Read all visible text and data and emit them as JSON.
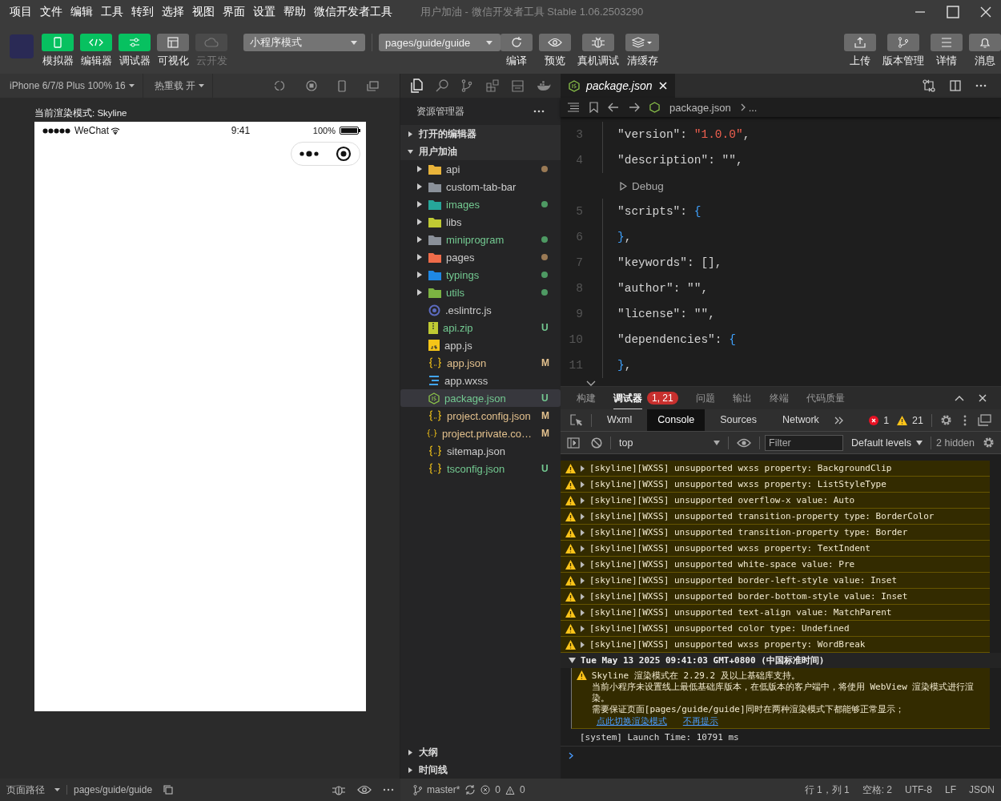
{
  "menu": [
    "项目",
    "文件",
    "编辑",
    "工具",
    "转到",
    "选择",
    "视图",
    "界面",
    "设置",
    "帮助",
    "微信开发者工具"
  ],
  "window": {
    "title": "用户加油 - 微信开发者工具 Stable 1.06.2503290"
  },
  "toolbar": {
    "modes": [
      {
        "label": "模拟器",
        "on": true,
        "disabled": false
      },
      {
        "label": "编辑器",
        "on": true,
        "disabled": false
      },
      {
        "label": "调试器",
        "on": true,
        "disabled": false
      },
      {
        "label": "可视化",
        "on": false,
        "disabled": false
      },
      {
        "label": "云开发",
        "on": false,
        "disabled": true
      }
    ],
    "mode_select": "小程序模式",
    "page_select": "pages/guide/guide",
    "actions": [
      "编译",
      "预览",
      "真机调试",
      "清缓存"
    ],
    "right_actions": [
      "上传",
      "版本管理",
      "详情",
      "消息"
    ]
  },
  "simulator": {
    "device": "iPhone 6/7/8 Plus 100% 16",
    "hot_reload": "热重载 开",
    "render_mode": "当前渲染模式: Skyline",
    "carrier": "WeChat",
    "time": "9:41",
    "battery": "100%"
  },
  "explorer": {
    "title": "资源管理器",
    "sections": [
      {
        "label": "打开的编辑器",
        "expanded": false
      },
      {
        "label": "用户加油",
        "expanded": true
      }
    ],
    "files": [
      {
        "name": "api",
        "kind": "folder",
        "color": "#e8b33a",
        "untracked": false,
        "modified": true,
        "selected": false
      },
      {
        "name": "custom-tab-bar",
        "kind": "folder",
        "color": "#8a9099",
        "untracked": false,
        "modified": false,
        "selected": false
      },
      {
        "name": "images",
        "kind": "folder",
        "color": "#26a69a",
        "untracked": true,
        "modified": false,
        "selected": false
      },
      {
        "name": "libs",
        "kind": "folder",
        "color": "#c0ca33",
        "untracked": false,
        "modified": false,
        "selected": false
      },
      {
        "name": "miniprogram",
        "kind": "folder",
        "color": "#8a9099",
        "untracked": true,
        "modified": false,
        "selected": false
      },
      {
        "name": "pages",
        "kind": "folder",
        "color": "#ef6c4a",
        "untracked": false,
        "modified": true,
        "selected": false
      },
      {
        "name": "typings",
        "kind": "folder",
        "color": "#1e88e5",
        "untracked": true,
        "modified": false,
        "selected": false
      },
      {
        "name": "utils",
        "kind": "folder",
        "color": "#7cb342",
        "untracked": true,
        "modified": false,
        "selected": false
      },
      {
        "name": ".eslintrc.js",
        "kind": "eslint",
        "untracked": false,
        "modified": false,
        "selected": false
      },
      {
        "name": "api.zip",
        "kind": "zip",
        "untracked": true,
        "modified": false,
        "badge": "U",
        "selected": false
      },
      {
        "name": "app.js",
        "kind": "js",
        "untracked": false,
        "modified": false,
        "selected": false
      },
      {
        "name": "app.json",
        "kind": "json",
        "untracked": false,
        "modified": true,
        "badge": "M",
        "selected": false
      },
      {
        "name": "app.wxss",
        "kind": "wxss",
        "untracked": false,
        "modified": false,
        "selected": false
      },
      {
        "name": "package.json",
        "kind": "node",
        "untracked": true,
        "modified": false,
        "badge": "U",
        "selected": true
      },
      {
        "name": "project.config.json",
        "kind": "json",
        "untracked": false,
        "modified": true,
        "badge": "M",
        "selected": false
      },
      {
        "name": "project.private.co…",
        "kind": "json",
        "untracked": false,
        "modified": true,
        "badge": "M",
        "selected": false
      },
      {
        "name": "sitemap.json",
        "kind": "json",
        "untracked": false,
        "modified": false,
        "selected": false
      },
      {
        "name": "tsconfig.json",
        "kind": "json",
        "untracked": true,
        "modified": false,
        "badge": "U",
        "selected": false
      }
    ],
    "bottom_sections": [
      {
        "label": "大纲",
        "expanded": false
      },
      {
        "label": "时间线",
        "expanded": false
      }
    ]
  },
  "editor": {
    "tab": "package.json",
    "breadcrumb": [
      "package.json",
      "..."
    ],
    "lines": [
      {
        "kind": "code",
        "num": "3",
        "tokens": [
          {
            "kind": "key",
            "text": "\"version\""
          },
          {
            "kind": "punct",
            "text": ": "
          },
          {
            "kind": "str",
            "text": "\"1.0.0\""
          },
          {
            "kind": "punct",
            "text": ","
          }
        ]
      },
      {
        "kind": "code",
        "num": "4",
        "tokens": [
          {
            "kind": "key",
            "text": "\"description\""
          },
          {
            "kind": "punct",
            "text": ": \"\","
          }
        ]
      },
      {
        "kind": "lens",
        "text": "Debug"
      },
      {
        "kind": "code",
        "num": "5",
        "tokens": [
          {
            "kind": "key",
            "text": "\"scripts\""
          },
          {
            "kind": "punct",
            "text": ": "
          },
          {
            "kind": "brace",
            "text": "{"
          }
        ]
      },
      {
        "kind": "code",
        "num": "6",
        "tokens": [
          {
            "kind": "brace",
            "text": "}"
          },
          {
            "kind": "punct",
            "text": ","
          }
        ]
      },
      {
        "kind": "code",
        "num": "7",
        "tokens": [
          {
            "kind": "key",
            "text": "\"keywords\""
          },
          {
            "kind": "punct",
            "text": ": [],"
          }
        ]
      },
      {
        "kind": "code",
        "num": "8",
        "tokens": [
          {
            "kind": "key",
            "text": "\"author\""
          },
          {
            "kind": "punct",
            "text": ": \"\","
          }
        ]
      },
      {
        "kind": "code",
        "num": "9",
        "tokens": [
          {
            "kind": "key",
            "text": "\"license\""
          },
          {
            "kind": "punct",
            "text": ": \"\","
          }
        ]
      },
      {
        "kind": "code",
        "num": "10",
        "tokens": [
          {
            "kind": "key",
            "text": "\"dependencies\""
          },
          {
            "kind": "punct",
            "text": ": "
          },
          {
            "kind": "brace",
            "text": "{"
          }
        ]
      },
      {
        "kind": "code",
        "num": "11",
        "tokens": [
          {
            "kind": "brace",
            "text": "}"
          },
          {
            "kind": "punct",
            "text": ","
          }
        ]
      }
    ]
  },
  "panel": {
    "tabs": [
      {
        "label": "构建",
        "selected": false
      },
      {
        "label": "调试器",
        "selected": true,
        "badge": "1, 21"
      },
      {
        "label": "问题",
        "selected": false
      },
      {
        "label": "输出",
        "selected": false
      },
      {
        "label": "终端",
        "selected": false
      },
      {
        "label": "代码质量",
        "selected": false
      }
    ],
    "devtools_tabs": [
      {
        "label": "Wxml",
        "selected": false
      },
      {
        "label": "Console",
        "selected": true
      },
      {
        "label": "Sources",
        "selected": false
      },
      {
        "label": "Network",
        "selected": false
      }
    ],
    "errors": "1",
    "warnings": "21",
    "console": {
      "context": "top",
      "filter_placeholder": "Filter",
      "levels": "Default levels",
      "hidden": "2 hidden",
      "warnings": [
        "[skyline][WXSS] unsupported wxss property: BackgroundClip",
        "[skyline][WXSS] unsupported wxss property: ListStyleType",
        "[skyline][WXSS] unsupported overflow-x value: Auto",
        "[skyline][WXSS] unsupported transition-property type: BorderColor",
        "[skyline][WXSS] unsupported transition-property type: Border",
        "[skyline][WXSS] unsupported wxss property: TextIndent",
        "[skyline][WXSS] unsupported white-space value: Pre",
        "[skyline][WXSS] unsupported border-left-style value: Inset",
        "[skyline][WXSS] unsupported border-bottom-style value: Inset",
        "[skyline][WXSS] unsupported text-align value: MatchParent",
        "[skyline][WXSS] unsupported color type: Undefined",
        "[skyline][WXSS] unsupported wxss property: WordBreak"
      ],
      "group": {
        "title": "Tue May 13 2025 09:41:03 GMT+0800 (中国标准时间)",
        "expanded": true,
        "lines": [
          "Skyline 渲染模式在 2.29.2 及以上基础库支持。",
          "当前小程序未设置线上最低基础库版本，在低版本的客户端中，将使用 WebView 渲染模式进行渲染。",
          "需要保证页面[pages/guide/guide]同时在两种渲染模式下都能够正常显示；"
        ],
        "links": [
          "点此切换渲染模式",
          "不再提示"
        ]
      },
      "system": "[system] Launch Time: 10791 ms"
    }
  },
  "status_bar": {
    "page_path_label": "页面路径",
    "page_path": "pages/guide/guide",
    "branch": "master*",
    "errors": "0",
    "warnings": "0",
    "right": [
      "行 1，列 1",
      "空格: 2",
      "UTF-8",
      "LF",
      "JSON"
    ]
  }
}
